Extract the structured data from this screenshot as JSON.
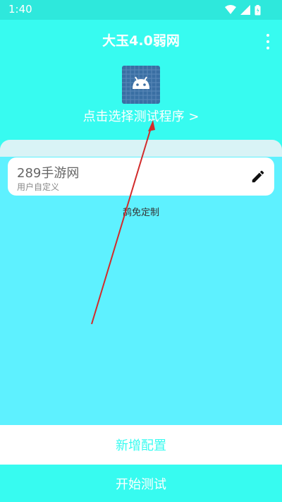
{
  "status_bar": {
    "time": "1:40",
    "icons": [
      "wifi-icon",
      "signal-icon",
      "battery-icon"
    ]
  },
  "app_bar": {
    "title": "大玉4.0弱网",
    "menu_icon": "more-vert-icon"
  },
  "header": {
    "app_icon": "android-icon",
    "select_program_label": "点击选择测试程序 >"
  },
  "config_card": {
    "name": "289手游网",
    "type_label": "用户自定义",
    "edit_icon": "pencil-icon"
  },
  "disclaimer": "鸹免定制",
  "actions": {
    "add_config_label": "新增配置",
    "start_test_label": "开始测试"
  },
  "colors": {
    "primary": "#37fbf0",
    "panel": "#5ef1ff",
    "annotation_arrow": "#d22b2b"
  }
}
